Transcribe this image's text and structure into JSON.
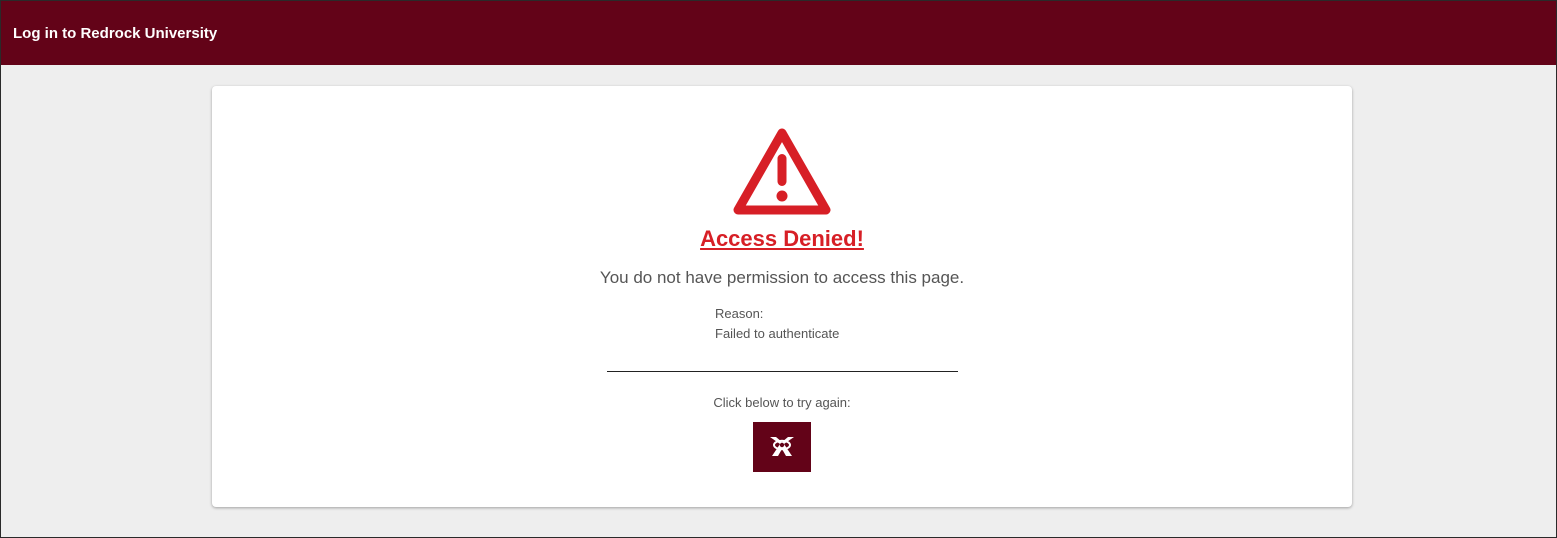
{
  "header": {
    "title": "Log in to Redrock University"
  },
  "colors": {
    "brand": "#630318",
    "alert": "#d71f26",
    "text": "#555555",
    "background": "#eeeeee"
  },
  "alert": {
    "icon": "warning-triangle-icon",
    "headline": "Access Denied!",
    "message": "You do not have permission to access this page.",
    "reason_label": "Reason:",
    "reason_text": "Failed to authenticate"
  },
  "retry": {
    "prompt": "Click below to try again:",
    "button_icon": "login-provider-logo-icon"
  }
}
